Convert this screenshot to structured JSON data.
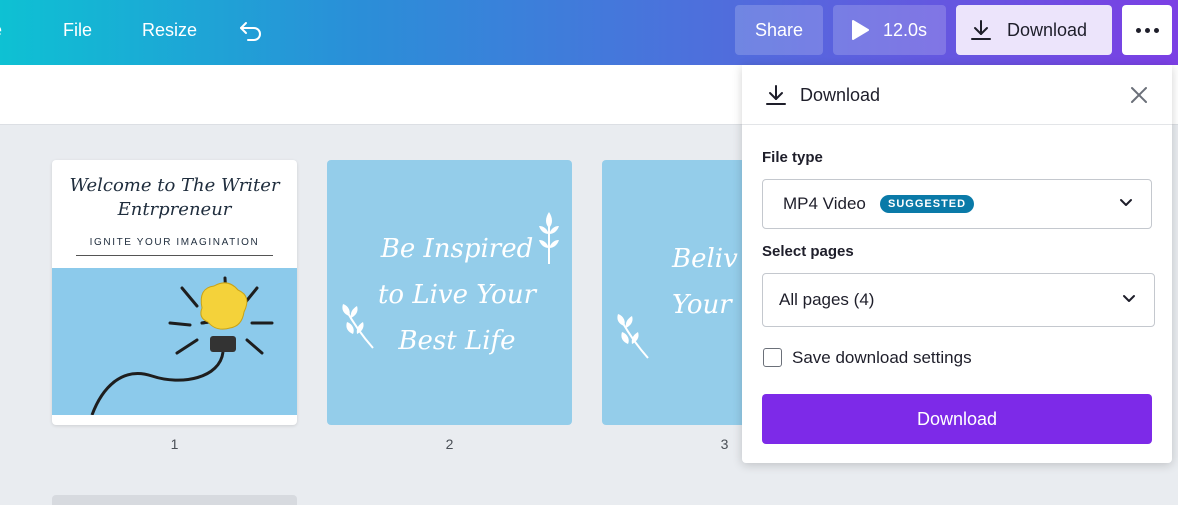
{
  "topbar": {
    "menu": [
      "e",
      "File",
      "Resize"
    ],
    "share_label": "Share",
    "play_label": "12.0s",
    "download_label": "Download"
  },
  "pages": [
    {
      "number": "1",
      "title_lines": [
        "Welcome to The Writer",
        "Entrpreneur"
      ],
      "subtitle": "IGNITE YOUR IMAGINATION"
    },
    {
      "number": "2",
      "script_lines": [
        "Be Inspired",
        "to Live Your",
        "Best Life"
      ]
    },
    {
      "number": "3",
      "script_lines": [
        "Beliv",
        "Your"
      ]
    }
  ],
  "download_panel": {
    "title": "Download",
    "file_type_label": "File type",
    "file_type_value": "MP4 Video",
    "suggested_badge": "SUGGESTED",
    "select_pages_label": "Select pages",
    "select_pages_value": "All pages (4)",
    "save_settings_label": "Save download settings",
    "save_settings_checked": false,
    "download_button": "Download"
  },
  "colors": {
    "accent": "#7d2ae8",
    "badge": "#0a7aa8",
    "page_bg": "#94cdea"
  }
}
